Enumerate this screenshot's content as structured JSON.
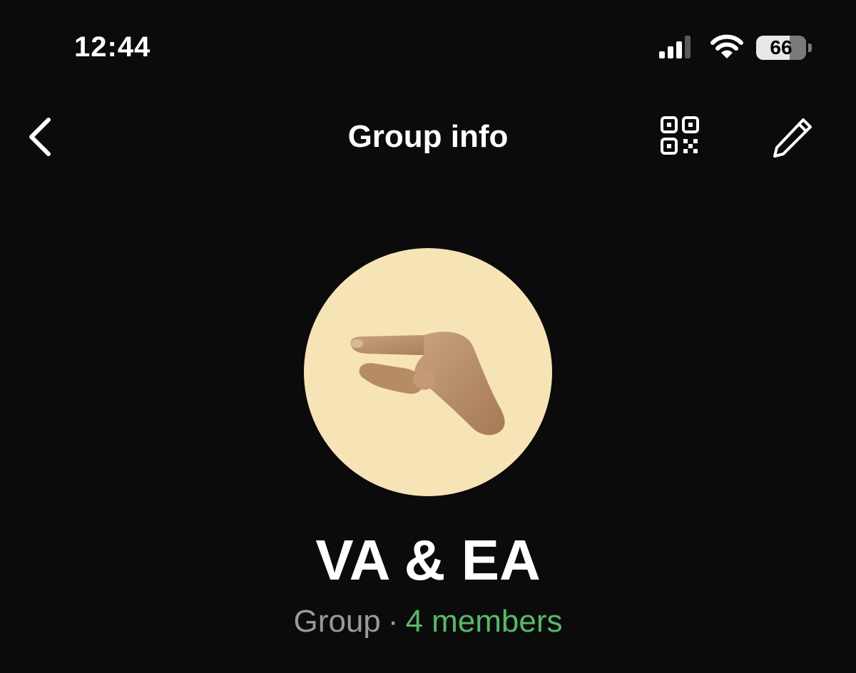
{
  "status_bar": {
    "time": "12:44",
    "battery_level": "66",
    "icons": [
      "cellular-signal-icon",
      "wifi-icon",
      "battery-icon"
    ]
  },
  "nav": {
    "title": "Group info",
    "back_icon": "chevron-left-icon",
    "qr_icon": "qr-code-icon",
    "edit_icon": "pencil-icon"
  },
  "group": {
    "avatar_icon": "pinched-fingers-hand-emoji",
    "name": "VA & EA",
    "type": "Group",
    "separator": "·",
    "members": "4 members"
  },
  "colors": {
    "background": "#0b0b0b",
    "text": "#ffffff",
    "secondary_text": "#9a9a9a",
    "accent_green": "#58b86a",
    "avatar_background": "#f7e4b6"
  }
}
